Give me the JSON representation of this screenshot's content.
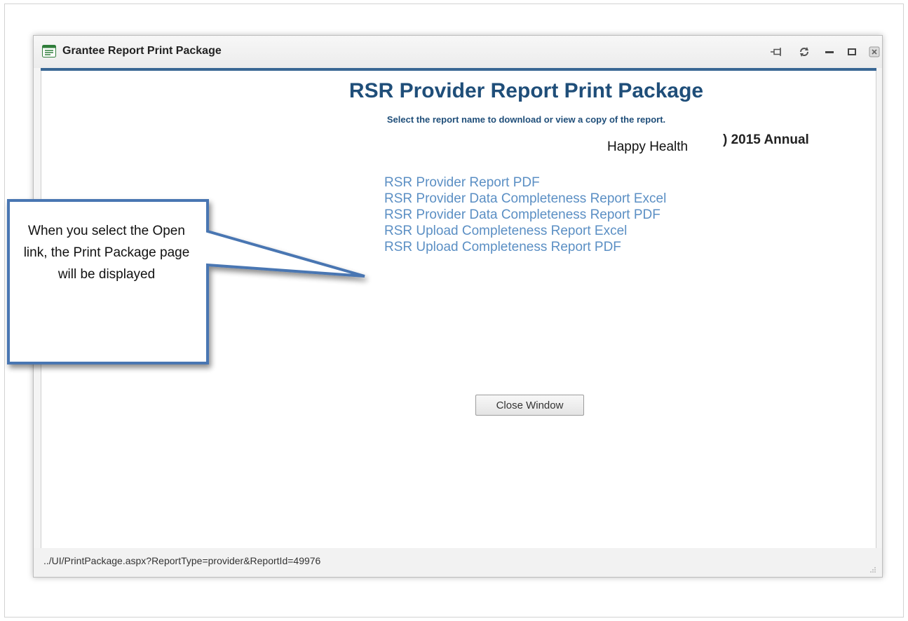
{
  "window": {
    "title": "Grantee Report Print Package",
    "controls": [
      "pin-icon",
      "refresh-icon",
      "minimize-icon",
      "maximize-icon",
      "close-icon"
    ]
  },
  "page": {
    "title": "RSR Provider Report Print Package",
    "subtitle": "Select the report name to download or view a copy of the report.",
    "grantee_name": "Happy Health",
    "period": ") 2015 Annual",
    "links": [
      {
        "label": "RSR Provider Report PDF"
      },
      {
        "label": "RSR Provider Data Completeness Report Excel"
      },
      {
        "label": "RSR Provider Data Completeness Report PDF"
      },
      {
        "label": "RSR Upload Completeness Report Excel"
      },
      {
        "label": "RSR Upload Completeness Report PDF"
      }
    ],
    "close_button": "Close Window"
  },
  "status_bar": {
    "url": "../UI/PrintPackage.aspx?ReportType=provider&ReportId=49976"
  },
  "callout": {
    "text": "When you select the Open link, the Print Package page will be displayed"
  },
  "colors": {
    "accent": "#3a6794",
    "title": "#1f4e79",
    "link": "#5b8fc4",
    "callout_border": "#4a76b2"
  }
}
